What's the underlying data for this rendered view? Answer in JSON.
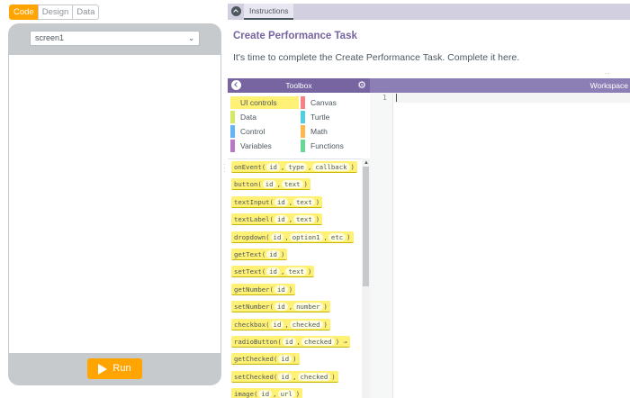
{
  "mode_tabs": [
    {
      "label": "Code",
      "active": true
    },
    {
      "label": "Design",
      "active": false
    },
    {
      "label": "Data",
      "active": false
    }
  ],
  "screen_selector": {
    "value": "screen1"
  },
  "run_button": {
    "label": "Run",
    "color": "#ffa400"
  },
  "instructions": {
    "tab_label": "Instructions",
    "title": "Create Performance Task",
    "text": "It's time to complete the Create Performance Task. Complete it here."
  },
  "toolbox": {
    "title": "Toolbox",
    "categories": [
      {
        "label": "UI controls",
        "color": "#fff176",
        "selected": true
      },
      {
        "label": "Canvas",
        "color": "#f78183",
        "selected": false
      },
      {
        "label": "Data",
        "color": "#d3e965",
        "selected": false
      },
      {
        "label": "Turtle",
        "color": "#4dd0e1",
        "selected": false
      },
      {
        "label": "Control",
        "color": "#64b5f6",
        "selected": false
      },
      {
        "label": "Math",
        "color": "#ffb74d",
        "selected": false
      },
      {
        "label": "Variables",
        "color": "#bb77c7",
        "selected": false
      },
      {
        "label": "Functions",
        "color": "#68d995",
        "selected": false
      }
    ],
    "blocks": [
      {
        "name": "onEvent",
        "params": [
          "id",
          "type",
          "callback"
        ]
      },
      {
        "name": "button",
        "params": [
          "id",
          "text"
        ]
      },
      {
        "name": "textInput",
        "params": [
          "id",
          "text"
        ]
      },
      {
        "name": "textLabel",
        "params": [
          "id",
          "text"
        ]
      },
      {
        "name": "dropdown",
        "params": [
          "id",
          "option1",
          "etc"
        ]
      },
      {
        "name": "getText",
        "params": [
          "id"
        ]
      },
      {
        "name": "setText",
        "params": [
          "id",
          "text"
        ]
      },
      {
        "name": "getNumber",
        "params": [
          "id"
        ]
      },
      {
        "name": "setNumber",
        "params": [
          "id",
          "number"
        ]
      },
      {
        "name": "checkbox",
        "params": [
          "id",
          "checked"
        ]
      },
      {
        "name": "radioButton",
        "params": [
          "id",
          "checked"
        ],
        "suffix": "→"
      },
      {
        "name": "getChecked",
        "params": [
          "id"
        ]
      },
      {
        "name": "setChecked",
        "params": [
          "id",
          "checked"
        ]
      },
      {
        "name": "image",
        "params": [
          "id",
          "url"
        ]
      }
    ]
  },
  "workspace": {
    "title": "Workspace",
    "line_numbers": [
      "1"
    ]
  },
  "colors": {
    "accent_orange": "#ffa400",
    "header_purple": "#7665a0",
    "instructions_bar": "#d2cfe1",
    "ui_controls_yellow": "#fff176"
  }
}
